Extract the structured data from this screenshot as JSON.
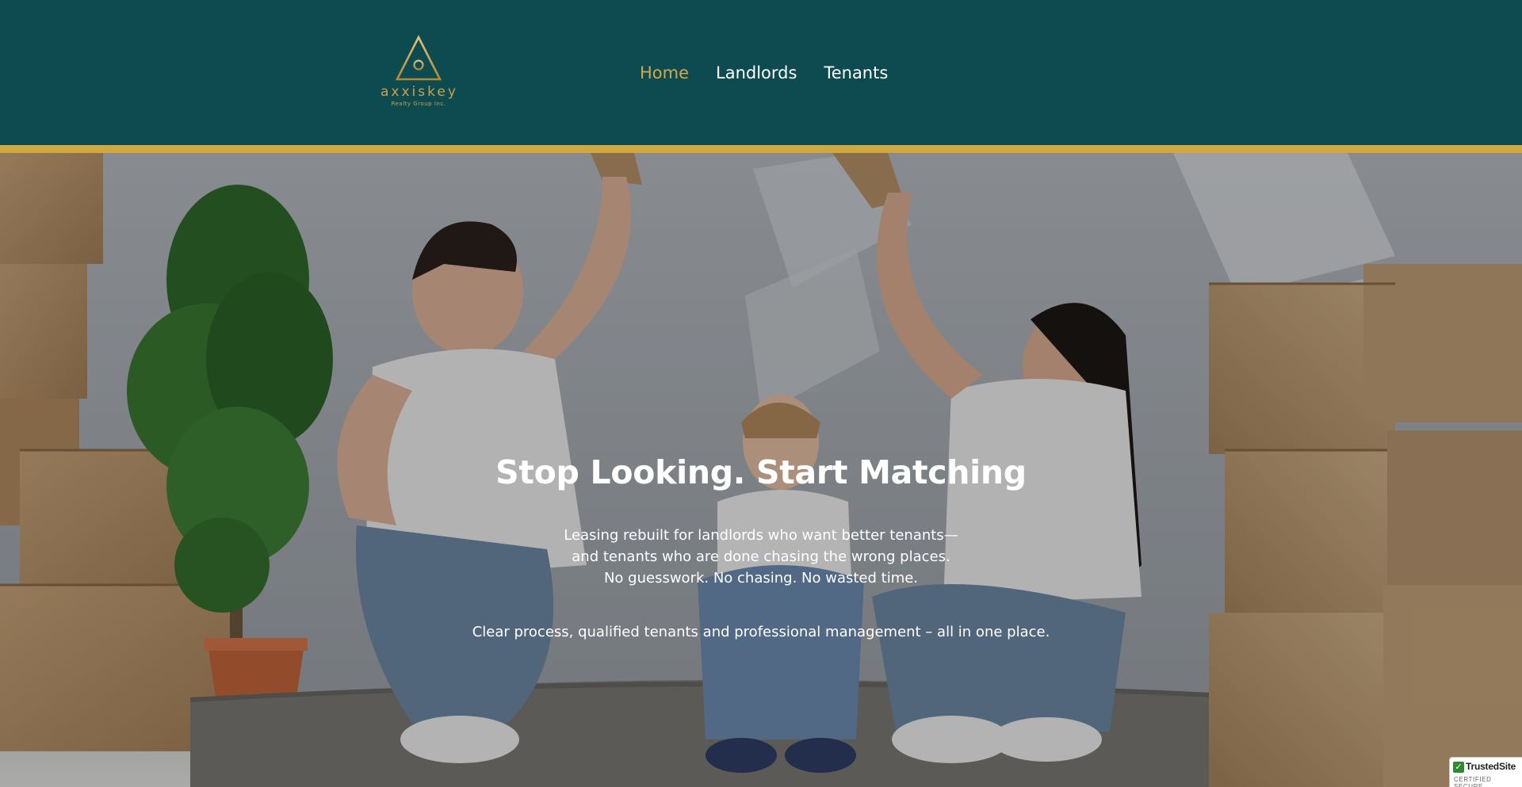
{
  "brand": {
    "logo_word": "axxiskey",
    "logo_sub": "Realty Group Inc."
  },
  "nav": {
    "items": [
      "Home",
      "Landlords",
      "Tenants"
    ],
    "active": "Home"
  },
  "hero": {
    "title": "Stop Looking. Start Matching",
    "lines": [
      "Leasing rebuilt for landlords who want better tenants—",
      "and tenants who are done chasing the wrong places.",
      "No guesswork. No chasing. No wasted time."
    ],
    "tagline": "Clear process, qualified tenants and professional management – all in one place."
  },
  "trust_badge": {
    "name": "TrustedSite",
    "subtitle": "CERTIFIED SECURE"
  },
  "colors": {
    "header_bg": "#0d4b51",
    "accent_gold": "#d1a73f",
    "nav_active": "#d3a848",
    "nav_text": "#ffffff"
  }
}
